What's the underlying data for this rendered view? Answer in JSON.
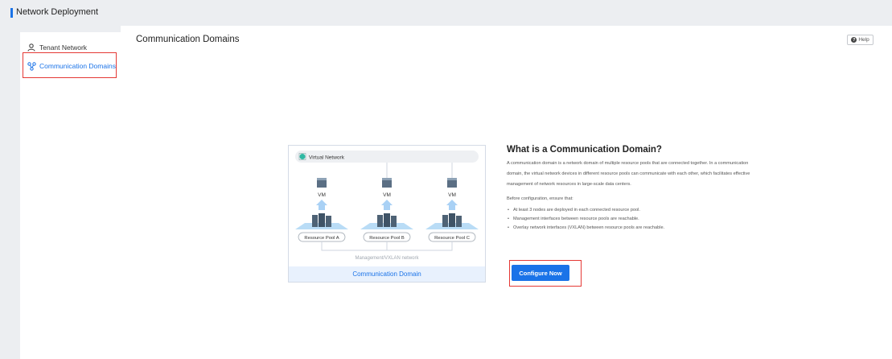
{
  "app": {
    "title": "Network Deployment"
  },
  "sidebar": {
    "items": [
      {
        "label": "Tenant Network",
        "icon": "user-icon",
        "active": false
      },
      {
        "label": "Communication Domains",
        "icon": "topology-icon",
        "active": true
      }
    ]
  },
  "main": {
    "title": "Communication Domains",
    "help_label": "Help"
  },
  "illustration": {
    "virtual_network_label": "Virtual Network",
    "vm_labels": [
      "VM",
      "VM",
      "VM"
    ],
    "pool_labels": [
      "Resource Pool A",
      "Resource Pool B",
      "Resource Pool C"
    ],
    "network_label": "Management/VXLAN network",
    "caption": "Communication Domain"
  },
  "info": {
    "heading": "What is a Communication Domain?",
    "description": "A communication domain is a network domain of multiple resource pools that are connected together. In a communication domain, the virtual network devices in different resource pools can communicate with each other, which facilitates effective management of network resources in large-scale data centers.",
    "before_text": "Before configuration, ensure that:",
    "requirements": [
      "At least 3 nodes are deployed in each connected resource pool.",
      "Management interfaces between resource pools are reachable.",
      "Overlay network interfaces (VXLAN) between resource pools are reachable."
    ],
    "configure_label": "Configure Now"
  },
  "colors": {
    "accent": "#1a73e8",
    "highlight": "#e53935",
    "background": "#eceef1"
  }
}
